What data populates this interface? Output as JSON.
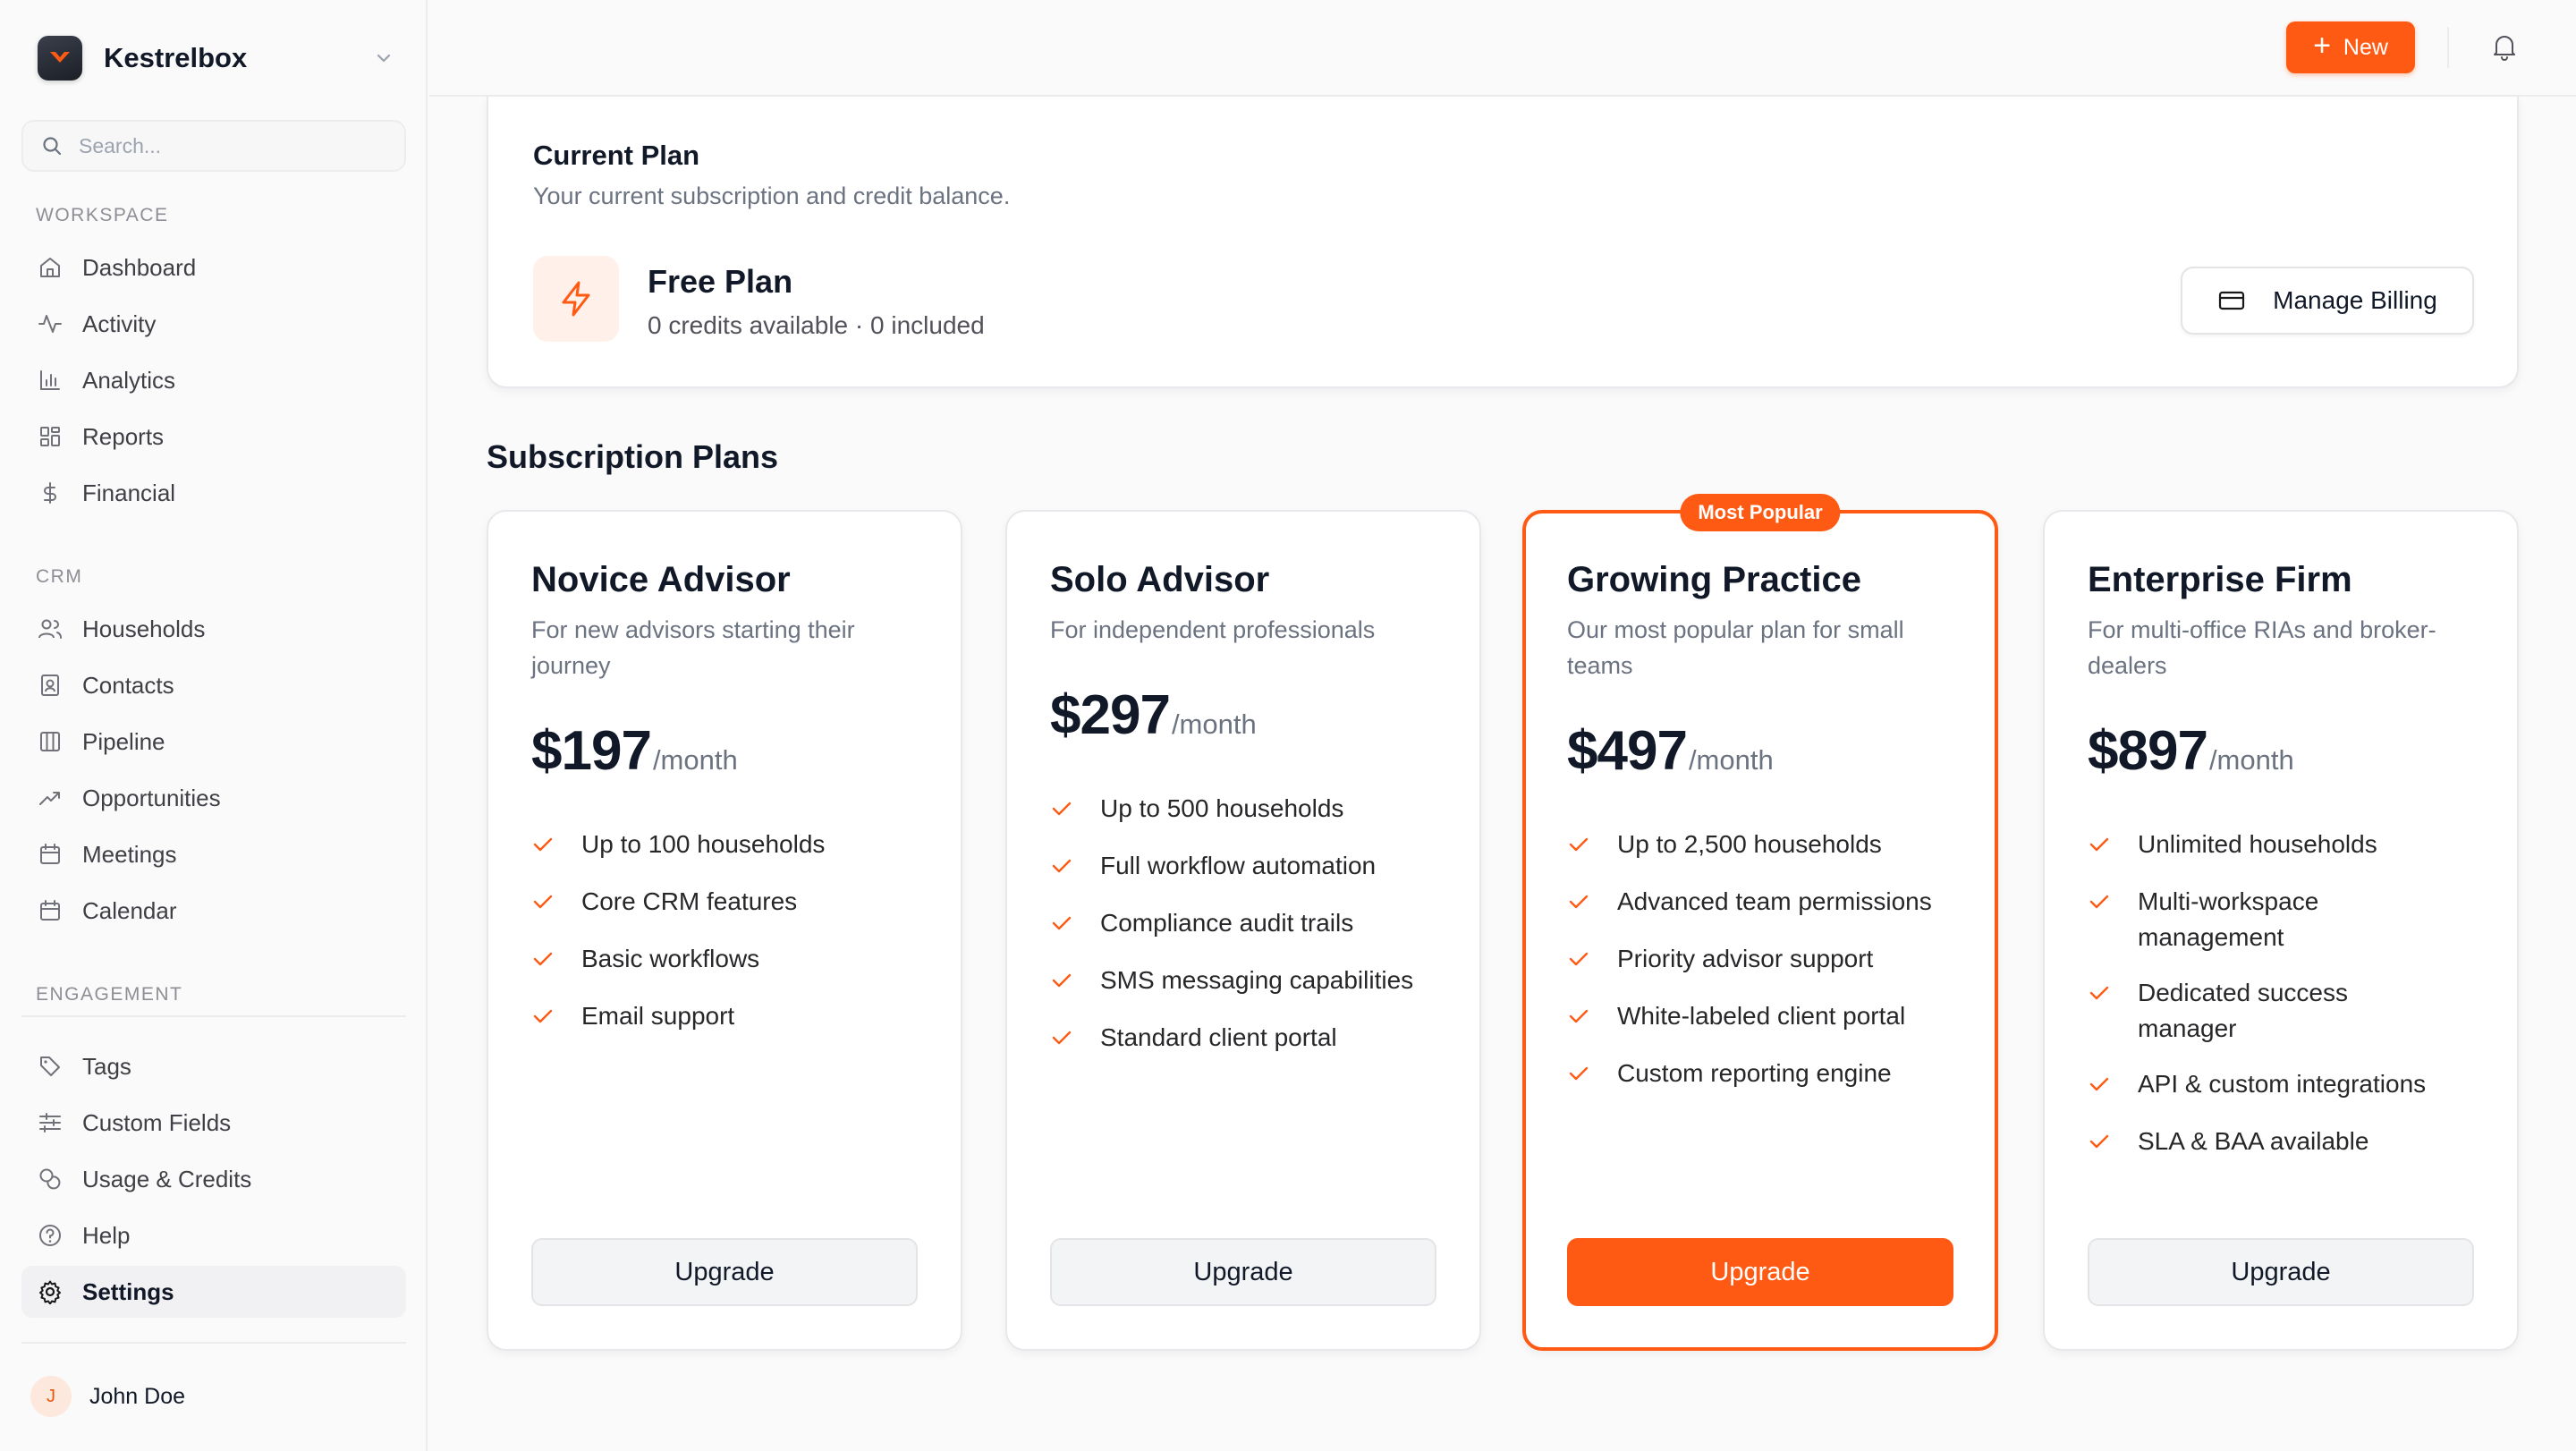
{
  "brand": {
    "name": "Kestrelbox"
  },
  "search": {
    "placeholder": "Search..."
  },
  "sections": {
    "workspace": "WORKSPACE",
    "crm": "CRM",
    "engagement": "ENGAGEMENT"
  },
  "nav": {
    "dashboard": "Dashboard",
    "activity": "Activity",
    "analytics": "Analytics",
    "reports": "Reports",
    "financial": "Financial",
    "households": "Households",
    "contacts": "Contacts",
    "pipeline": "Pipeline",
    "opportunities": "Opportunities",
    "meetings": "Meetings",
    "calendar": "Calendar",
    "tags": "Tags",
    "custom_fields": "Custom Fields",
    "usage_credits": "Usage & Credits",
    "help": "Help",
    "settings": "Settings"
  },
  "user": {
    "initial": "J",
    "name": "John Doe"
  },
  "topbar": {
    "new_label": "New"
  },
  "current_plan": {
    "title": "Current Plan",
    "subtitle": "Your current subscription and credit balance.",
    "plan_name": "Free Plan",
    "credits": "0 credits available · 0 included",
    "billing_button": "Manage Billing"
  },
  "plans_heading": "Subscription Plans",
  "plans": [
    {
      "name": "Novice Advisor",
      "description": "For new advisors starting their journey",
      "price": "$197",
      "period": "/month",
      "features": [
        "Up to 100 households",
        "Core CRM features",
        "Basic workflows",
        "Email support"
      ],
      "button": "Upgrade"
    },
    {
      "name": "Solo Advisor",
      "description": "For independent professionals",
      "price": "$297",
      "period": "/month",
      "features": [
        "Up to 500 households",
        "Full workflow automation",
        "Compliance audit trails",
        "SMS messaging capabilities",
        "Standard client portal"
      ],
      "button": "Upgrade"
    },
    {
      "name": "Growing Practice",
      "badge": "Most Popular",
      "description": "Our most popular plan for small teams",
      "price": "$497",
      "period": "/month",
      "features": [
        "Up to 2,500 households",
        "Advanced team permissions",
        "Priority advisor support",
        "White-labeled client portal",
        "Custom reporting engine"
      ],
      "button": "Upgrade"
    },
    {
      "name": "Enterprise Firm",
      "description": "For multi-office RIAs and broker-dealers",
      "price": "$897",
      "period": "/month",
      "features": [
        "Unlimited households",
        "Multi-workspace management",
        "Dedicated success manager",
        "API & custom integrations",
        "SLA & BAA available"
      ],
      "button": "Upgrade"
    }
  ],
  "colors": {
    "accent": "#ff5a14",
    "accent_soft": "#fff1ea"
  }
}
